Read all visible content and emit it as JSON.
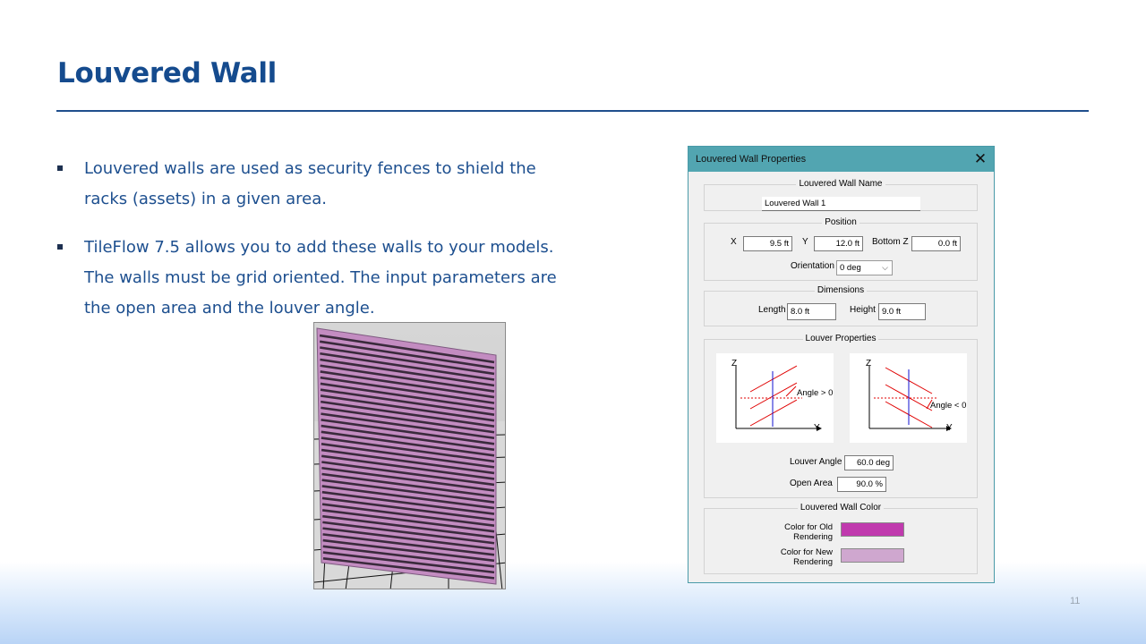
{
  "slide": {
    "title": "Louvered Wall",
    "bullets": [
      "Louvered walls are used as security fences to shield the racks (assets) in a given area.",
      "TileFlow 7.5 allows you to add these walls to your models. The walls must be grid oriented. The input parameters are the open area and the louver angle."
    ],
    "page_number": "11"
  },
  "dialog": {
    "title": "Louvered Wall Properties",
    "close_icon": "close-icon",
    "name_group": {
      "label": "Louvered Wall Name",
      "value": "Louvered Wall 1"
    },
    "position_group": {
      "label": "Position",
      "x_label": "X",
      "x_value": "9.5 ft",
      "y_label": "Y",
      "y_value": "12.0 ft",
      "bottomz_label": "Bottom Z",
      "bottomz_value": "0.0 ft",
      "orientation_label": "Orientation",
      "orientation_value": "0 deg"
    },
    "dimensions_group": {
      "label": "Dimensions",
      "length_label": "Length",
      "length_value": "8.0 ft",
      "height_label": "Height",
      "height_value": "9.0 ft"
    },
    "louver_group": {
      "label": "Louver Properties",
      "diagram_left": {
        "z": "Z",
        "y": "Y",
        "angle": "Angle > 0"
      },
      "diagram_right": {
        "z": "Z",
        "y": "Y",
        "angle": "Angle < 0"
      },
      "angle_label": "Louver Angle",
      "angle_value": "60.0 deg",
      "open_area_label": "Open Area",
      "open_area_value": "90.0 %"
    },
    "color_group": {
      "label": "Louvered Wall Color",
      "old_label_1": "Color for Old",
      "old_label_2": "Rendering",
      "new_label_1": "Color for New",
      "new_label_2": "Rendering",
      "old_color": "#c03aae",
      "new_color": "#cfa7cf"
    }
  },
  "colors": {
    "title": "#154b8e",
    "text": "#1d4f8f",
    "dialog_titlebar": "#52a5b1"
  }
}
